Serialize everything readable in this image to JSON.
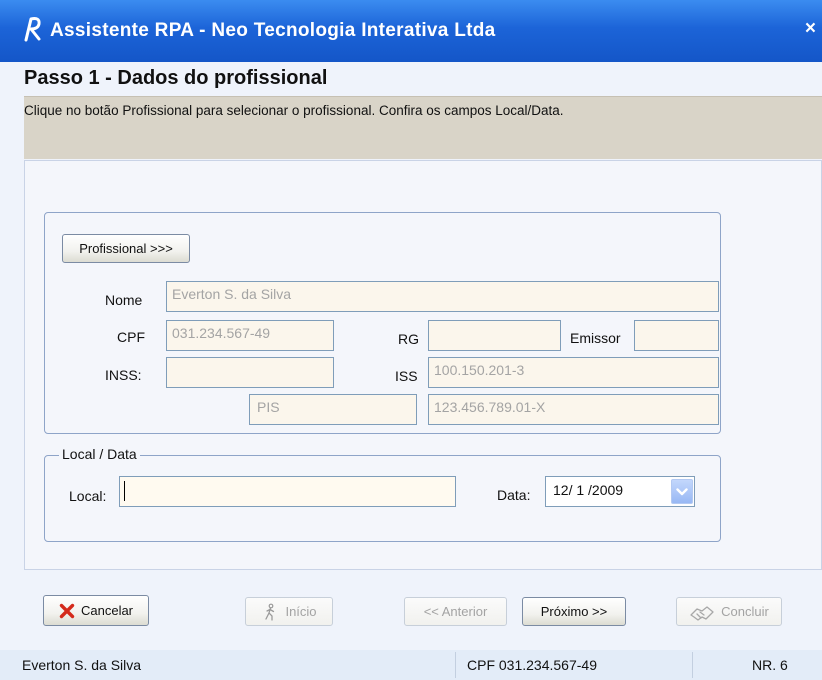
{
  "window": {
    "title": "Assistente RPA - Neo Tecnologia Interativa Ltda",
    "close_glyph": "×",
    "app_icon": "rpa-logo-icon"
  },
  "step": {
    "title": "Passo 1 -   Dados do profissional",
    "instructions": "Clique no botão Profissional para selecionar o profissional. Confira os campos Local/Data."
  },
  "professional": {
    "button_label": "Profissional >>>",
    "nome_label": "Nome",
    "nome_value": "Everton S. da Silva",
    "cpf_label": "CPF",
    "cpf_value": "031.234.567-49",
    "rg_label": "RG",
    "rg_value": "",
    "emissor_label": "Emissor",
    "emissor_value": "",
    "inss_label": "INSS:",
    "inss_value": "",
    "iss_label": "ISS",
    "iss_value": "100.150.201-3",
    "pis_label": "PIS",
    "pis_value": "123.456.789.01-X"
  },
  "local_data": {
    "legend": "Local / Data",
    "local_label": "Local:",
    "local_value": "",
    "data_label": "Data:",
    "data_value": "12/ 1 /2009"
  },
  "buttons": {
    "cancel": "Cancelar",
    "start": "Início",
    "previous": "<< Anterior",
    "next": "Próximo >>",
    "finish": "Concluir"
  },
  "status": {
    "name": "Everton S. da Silva",
    "cpf": "CPF 031.234.567-49",
    "nr": "NR. 6"
  },
  "colors": {
    "titlebar": "#1c64d8",
    "cancel_icon": "#d42a1c",
    "dropdown_button": "#98b8f4"
  }
}
